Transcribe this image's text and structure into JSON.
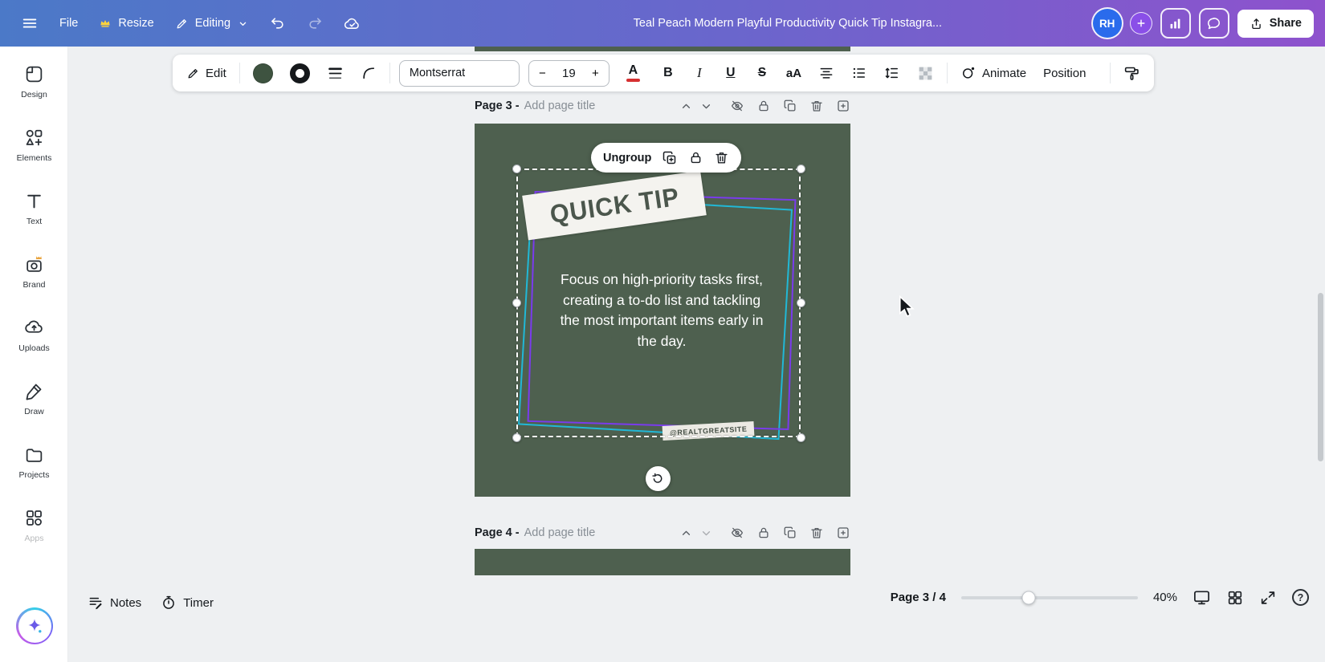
{
  "topbar": {
    "file_label": "File",
    "resize_label": "Resize",
    "editing_label": "Editing",
    "doc_title": "Teal Peach Modern Playful Productivity Quick Tip Instagra...",
    "avatar_initials": "RH",
    "share_label": "Share"
  },
  "sidebar": {
    "items": [
      {
        "label": "Design"
      },
      {
        "label": "Elements"
      },
      {
        "label": "Text"
      },
      {
        "label": "Brand"
      },
      {
        "label": "Uploads"
      },
      {
        "label": "Draw"
      },
      {
        "label": "Projects"
      },
      {
        "label": "Apps"
      }
    ]
  },
  "toolbar": {
    "edit_label": "Edit",
    "font_name": "Montserrat",
    "font_size": "19",
    "decrease_label": "−",
    "increase_label": "+",
    "bold_label": "B",
    "italic_label": "I",
    "underline_label": "U",
    "strikethrough_label": "S",
    "case_label": "aA",
    "animate_label": "Animate",
    "position_label": "Position"
  },
  "pages": {
    "page3": {
      "label": "Page 3 -",
      "placeholder": "Add page title"
    },
    "page4": {
      "label": "Page 4 -",
      "placeholder": "Add page title"
    }
  },
  "design": {
    "ungroup_label": "Ungroup",
    "badge_text": "QUICK TIP",
    "body_text": "Focus on high-priority tasks first, creating a to-do list and tackling the most important items early in the day.",
    "watermark": "@REALTGREATSITE"
  },
  "statusbar": {
    "notes_label": "Notes",
    "timer_label": "Timer",
    "page_indicator": "Page 3 / 4",
    "zoom_level": "40%",
    "help_glyph": "?"
  },
  "colors": {
    "canvas_green": "#4e604f",
    "selection_purple": "#7a3bed",
    "selection_cyan": "#21b8d6",
    "accent_red_underline": "#d63031"
  }
}
